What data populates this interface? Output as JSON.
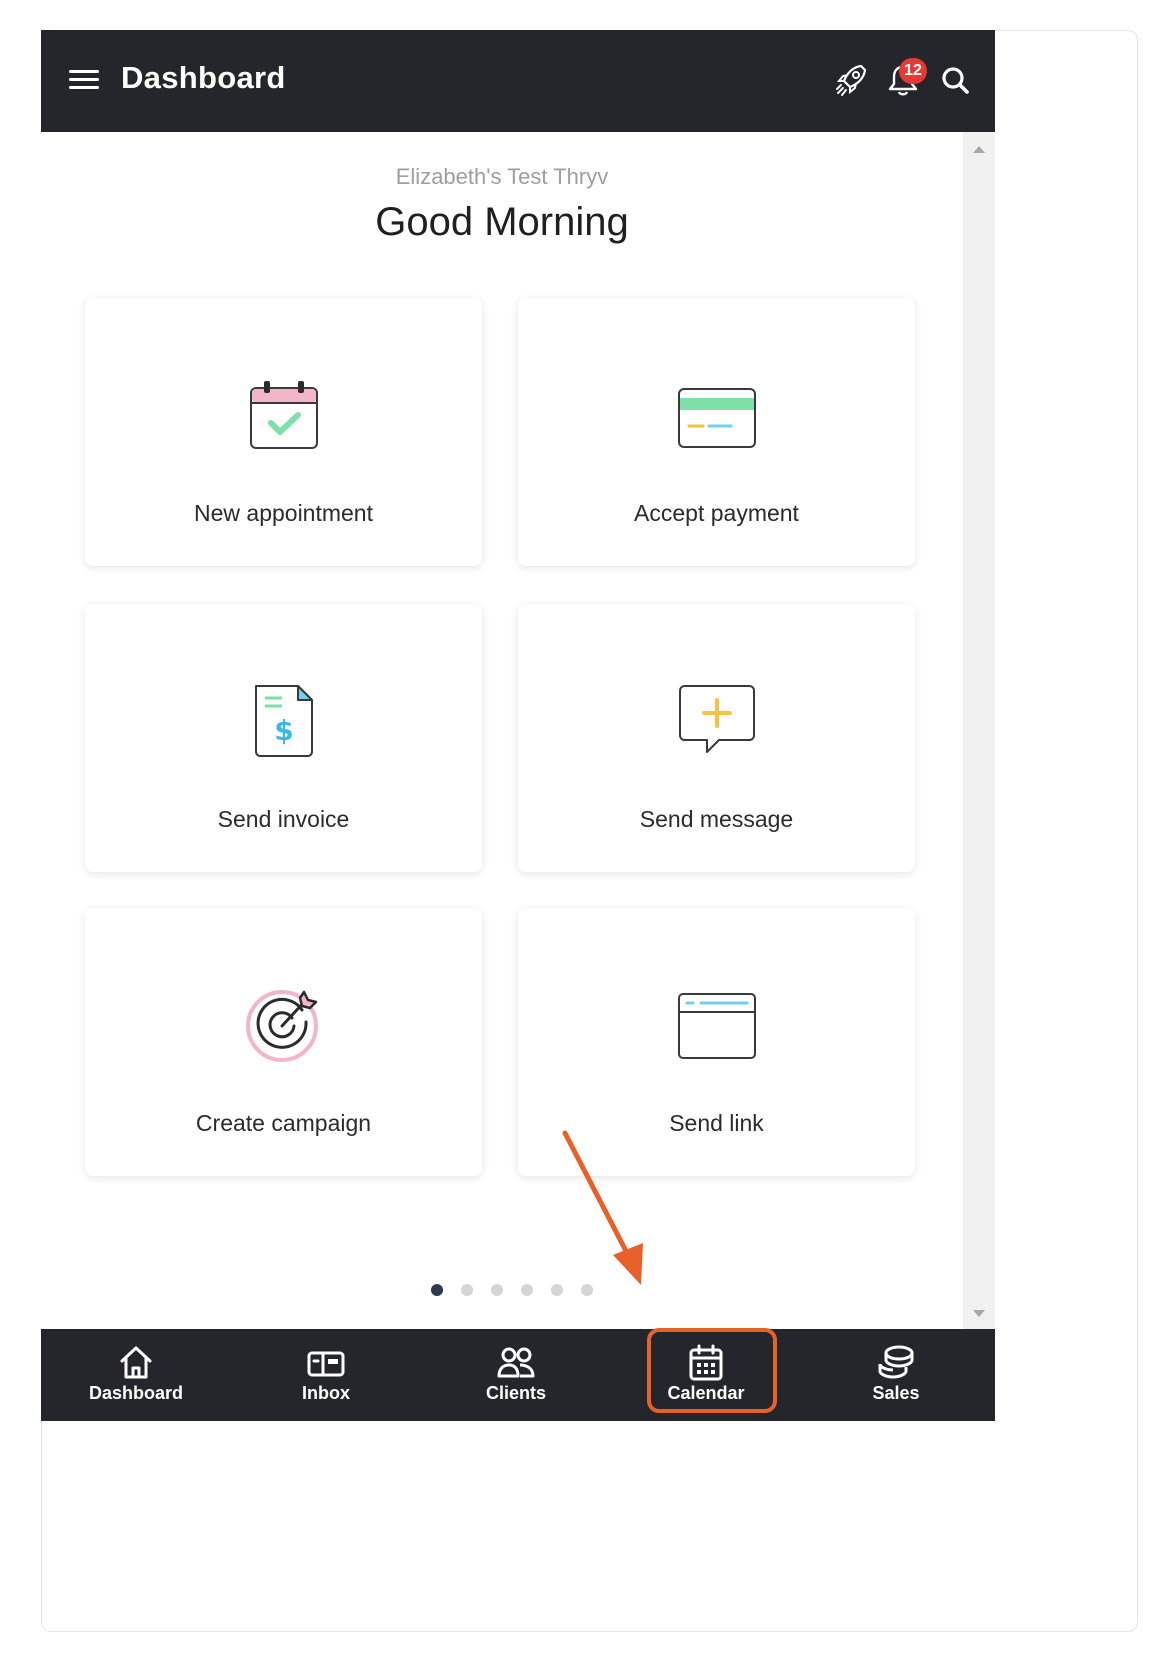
{
  "header": {
    "title": "Dashboard",
    "notification_count": "12",
    "icons": [
      "menu-icon",
      "rocket-icon",
      "bell-icon",
      "search-icon"
    ]
  },
  "main": {
    "business_name": "Elizabeth's Test Thryv",
    "greeting": "Good Morning",
    "cards": [
      {
        "label": "New appointment",
        "icon": "calendar-check-icon"
      },
      {
        "label": "Accept payment",
        "icon": "credit-card-icon"
      },
      {
        "label": "Send invoice",
        "icon": "invoice-icon"
      },
      {
        "label": "Send message",
        "icon": "message-plus-icon"
      },
      {
        "label": "Create campaign",
        "icon": "target-icon"
      },
      {
        "label": "Send link",
        "icon": "browser-window-icon"
      }
    ],
    "pagination": {
      "total": 6,
      "active": 1
    }
  },
  "bottom_nav": {
    "items": [
      {
        "label": "Dashboard",
        "icon": "home-icon"
      },
      {
        "label": "Inbox",
        "icon": "mailbox-icon"
      },
      {
        "label": "Clients",
        "icon": "users-icon"
      },
      {
        "label": "Calendar",
        "icon": "calendar-icon"
      },
      {
        "label": "Sales",
        "icon": "coins-icon"
      }
    ]
  },
  "annotation": {
    "highlight_color": "#e8612b"
  },
  "colors": {
    "header_bg": "#25262b",
    "badge": "#e53935",
    "accent_green": "#7ee0a8",
    "accent_pink": "#f3b6c8",
    "accent_blue": "#6fd0f0",
    "accent_yellow": "#f5c542"
  }
}
